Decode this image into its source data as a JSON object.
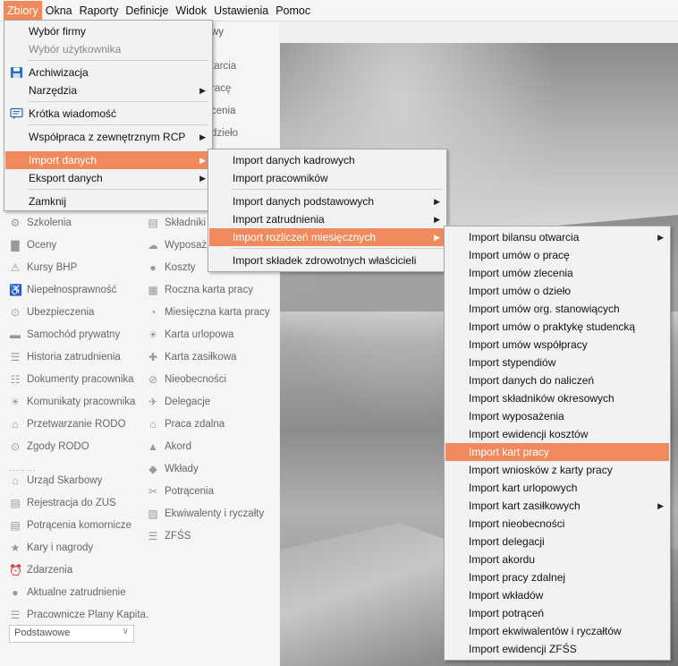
{
  "menubar": {
    "items": [
      "Zbiory",
      "Okna",
      "Raporty",
      "Definicje",
      "Widok",
      "Ustawienia",
      "Pomoc"
    ]
  },
  "left_panel": {
    "col1": [
      "Szkolenia",
      "Oceny",
      "Kursy BHP",
      "Niepełnosprawność",
      "Ubezpieczenia",
      "Samochód prywatny",
      "Historia zatrudnienia",
      "Dokumenty pracownika",
      "Komunikaty pracownika",
      "Przetwarzanie RODO",
      "Zgody RODO"
    ],
    "col1b": [
      "Urząd Skarbowy",
      "Rejestracja do ZUS",
      "Potrącenia komornicze",
      "Kary i nagrody",
      "Zdarzenia",
      "Aktualne zatrudnienie",
      "Pracownicze Plany Kapita."
    ],
    "col2": [
      "Składniki o",
      "Wyposaż",
      "Koszty",
      "Roczna karta pracy",
      "Miesięczna karta pracy",
      "Karta urlopowa",
      "Karta zasiłkowa",
      "Nieobecności",
      "Delegacje",
      "Praca zdalna",
      "Akord",
      "Wkłady",
      "Potrącenia",
      "Ekwiwalenty i ryczałty",
      "ZFŚS"
    ],
    "partial_labels": [
      "wy",
      "tarcia",
      "racę",
      "cenia",
      "dzieło"
    ],
    "dots": "........",
    "combo_value": "Podstawowe"
  },
  "menu_zbiory": {
    "items": [
      {
        "label": "Wybór firmy"
      },
      {
        "label": "Wybór użytkownika",
        "disabled": true
      },
      {
        "label": "Archiwizacja",
        "icon": "floppy-icon"
      },
      {
        "label": "Narzędzia",
        "submenu": true
      },
      {
        "label": "Krótka wiadomość",
        "icon": "message-icon"
      },
      {
        "label": "Współpraca z zewnętrznym RCP",
        "submenu": true
      },
      {
        "label": "Import danych",
        "submenu": true,
        "highlighted": true
      },
      {
        "label": "Eksport danych",
        "submenu": true
      },
      {
        "label": "Zamknij"
      }
    ]
  },
  "menu_import_danych": {
    "items": [
      {
        "label": "Import danych kadrowych"
      },
      {
        "label": "Import pracowników"
      },
      {
        "label": "Import danych podstawowych",
        "submenu": true
      },
      {
        "label": "Import zatrudnienia",
        "submenu": true
      },
      {
        "label": "Import rozliczeń miesięcznych",
        "submenu": true,
        "highlighted": true
      },
      {
        "label": "Import składek zdrowotnych właścicieli"
      }
    ]
  },
  "menu_import_rozliczen": {
    "items": [
      {
        "label": "Import bilansu otwarcia",
        "submenu": true
      },
      {
        "label": "Import umów o pracę"
      },
      {
        "label": "Import umów zlecenia"
      },
      {
        "label": "Import umów o dzieło"
      },
      {
        "label": "Import umów org. stanowiących"
      },
      {
        "label": "Import umów o praktykę studencką"
      },
      {
        "label": "Import umów współpracy"
      },
      {
        "label": "Import stypendiów"
      },
      {
        "label": "Import danych do naliczeń"
      },
      {
        "label": "Import składników okresowych"
      },
      {
        "label": "Import wyposażenia"
      },
      {
        "label": "Import ewidencji kosztów"
      },
      {
        "label": "Import kart pracy",
        "highlighted": true
      },
      {
        "label": "Import wniosków z karty pracy"
      },
      {
        "label": "Import kart urlopowych"
      },
      {
        "label": "Import kart zasiłkowych",
        "submenu": true
      },
      {
        "label": "Import nieobecności"
      },
      {
        "label": "Import delegacji"
      },
      {
        "label": "Import akordu"
      },
      {
        "label": "Import pracy zdalnej"
      },
      {
        "label": "Import wkładów"
      },
      {
        "label": "Import potrąceń"
      },
      {
        "label": "Import ekwiwalentów i ryczałtów"
      },
      {
        "label": "Import ewidencji ZFŚS"
      }
    ]
  },
  "colors": {
    "accent": "#f08a5d",
    "menu_bg": "#f2f2f2",
    "panel_bg": "#f5f5f5"
  }
}
